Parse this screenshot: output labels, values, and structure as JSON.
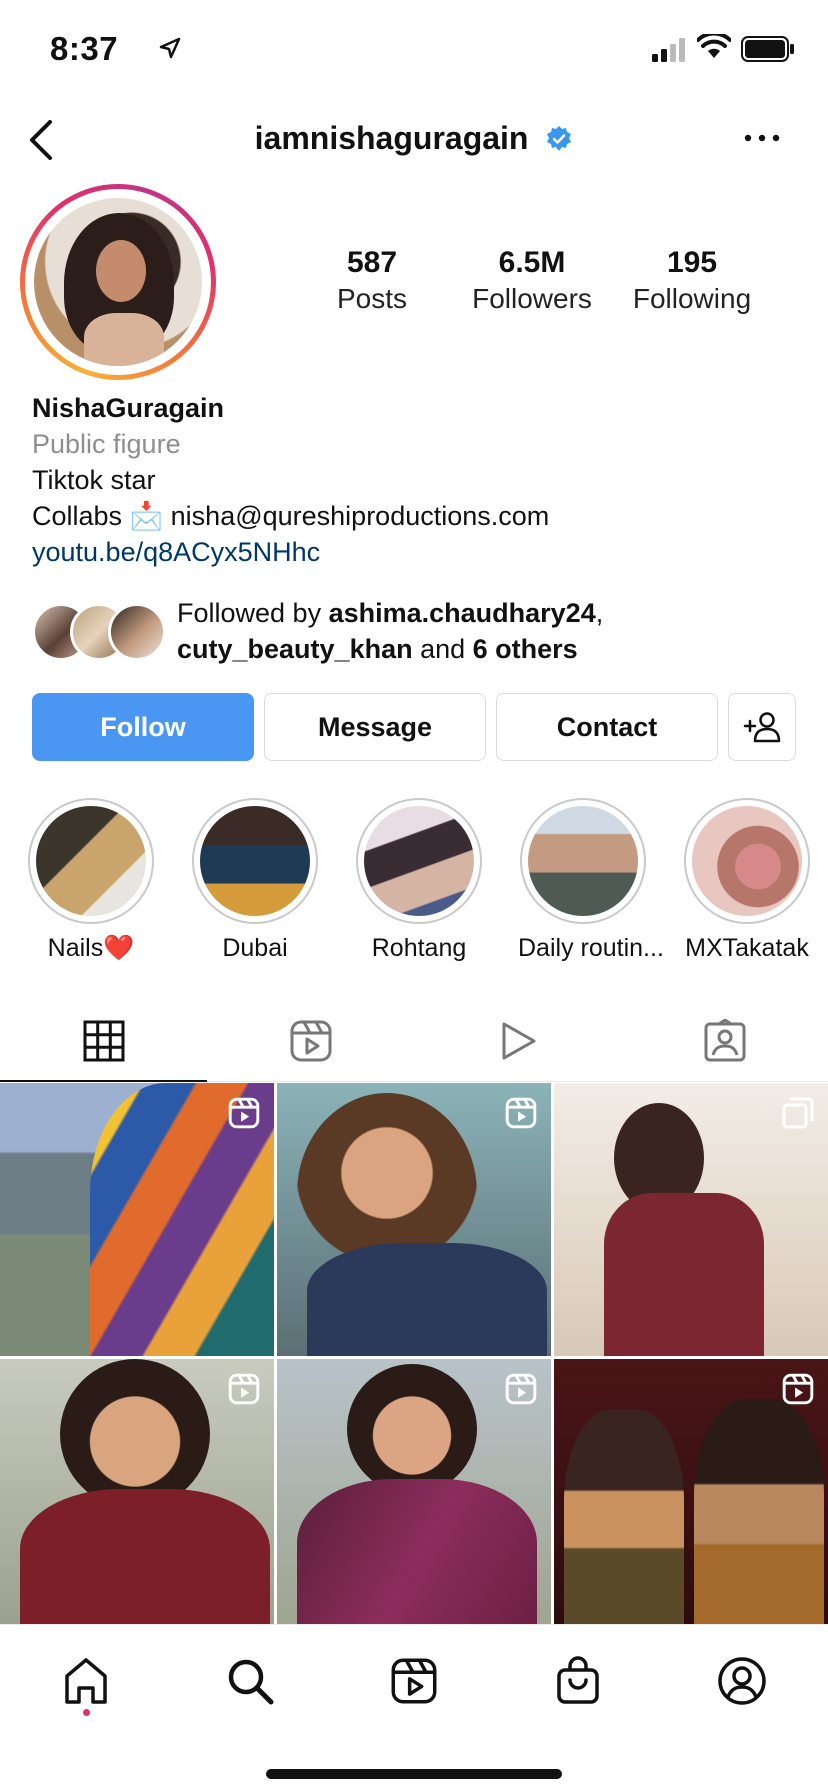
{
  "status_bar": {
    "time": "8:37",
    "icons": [
      "location-arrow-icon",
      "cellular-signal-icon",
      "wifi-icon",
      "battery-icon"
    ]
  },
  "header": {
    "username": "iamnishaguragain",
    "verified": true,
    "icons": [
      "back-chevron-icon",
      "verified-badge-icon",
      "more-dots-icon"
    ]
  },
  "stats": [
    {
      "value": "587",
      "label": "Posts"
    },
    {
      "value": "6.5M",
      "label": "Followers"
    },
    {
      "value": "195",
      "label": "Following"
    }
  ],
  "bio": {
    "name": "NishaGuragain",
    "category": "Public figure",
    "line1": "Tiktok star",
    "line2": "Collabs 📩 nisha@qureshiproductions.com",
    "link": "youtu.be/q8ACyx5NHhc"
  },
  "followed_by": {
    "prefix": "Followed by ",
    "user1": "ashima.chaudhary24",
    "sep": ",",
    "user2": "cuty_beauty_khan",
    "mid": " and ",
    "others": "6 others"
  },
  "buttons": {
    "follow": "Follow",
    "message": "Message",
    "contact": "Contact",
    "suggest_icon": "add-person-icon"
  },
  "highlights": [
    {
      "label": "Nails❤️"
    },
    {
      "label": "Dubai"
    },
    {
      "label": "Rohtang"
    },
    {
      "label": "Daily routin..."
    },
    {
      "label": "MXTakatak"
    }
  ],
  "tabs": [
    "grid-icon",
    "reels-icon",
    "play-icon",
    "tagged-icon"
  ],
  "nav": [
    "home-icon",
    "search-icon",
    "reels-icon",
    "shop-bag-icon",
    "profile-icon"
  ],
  "colors": {
    "accent": "#4a97f3",
    "link": "#00376b",
    "muted": "#8e8e8e",
    "notification_dot": "#e1306c"
  }
}
